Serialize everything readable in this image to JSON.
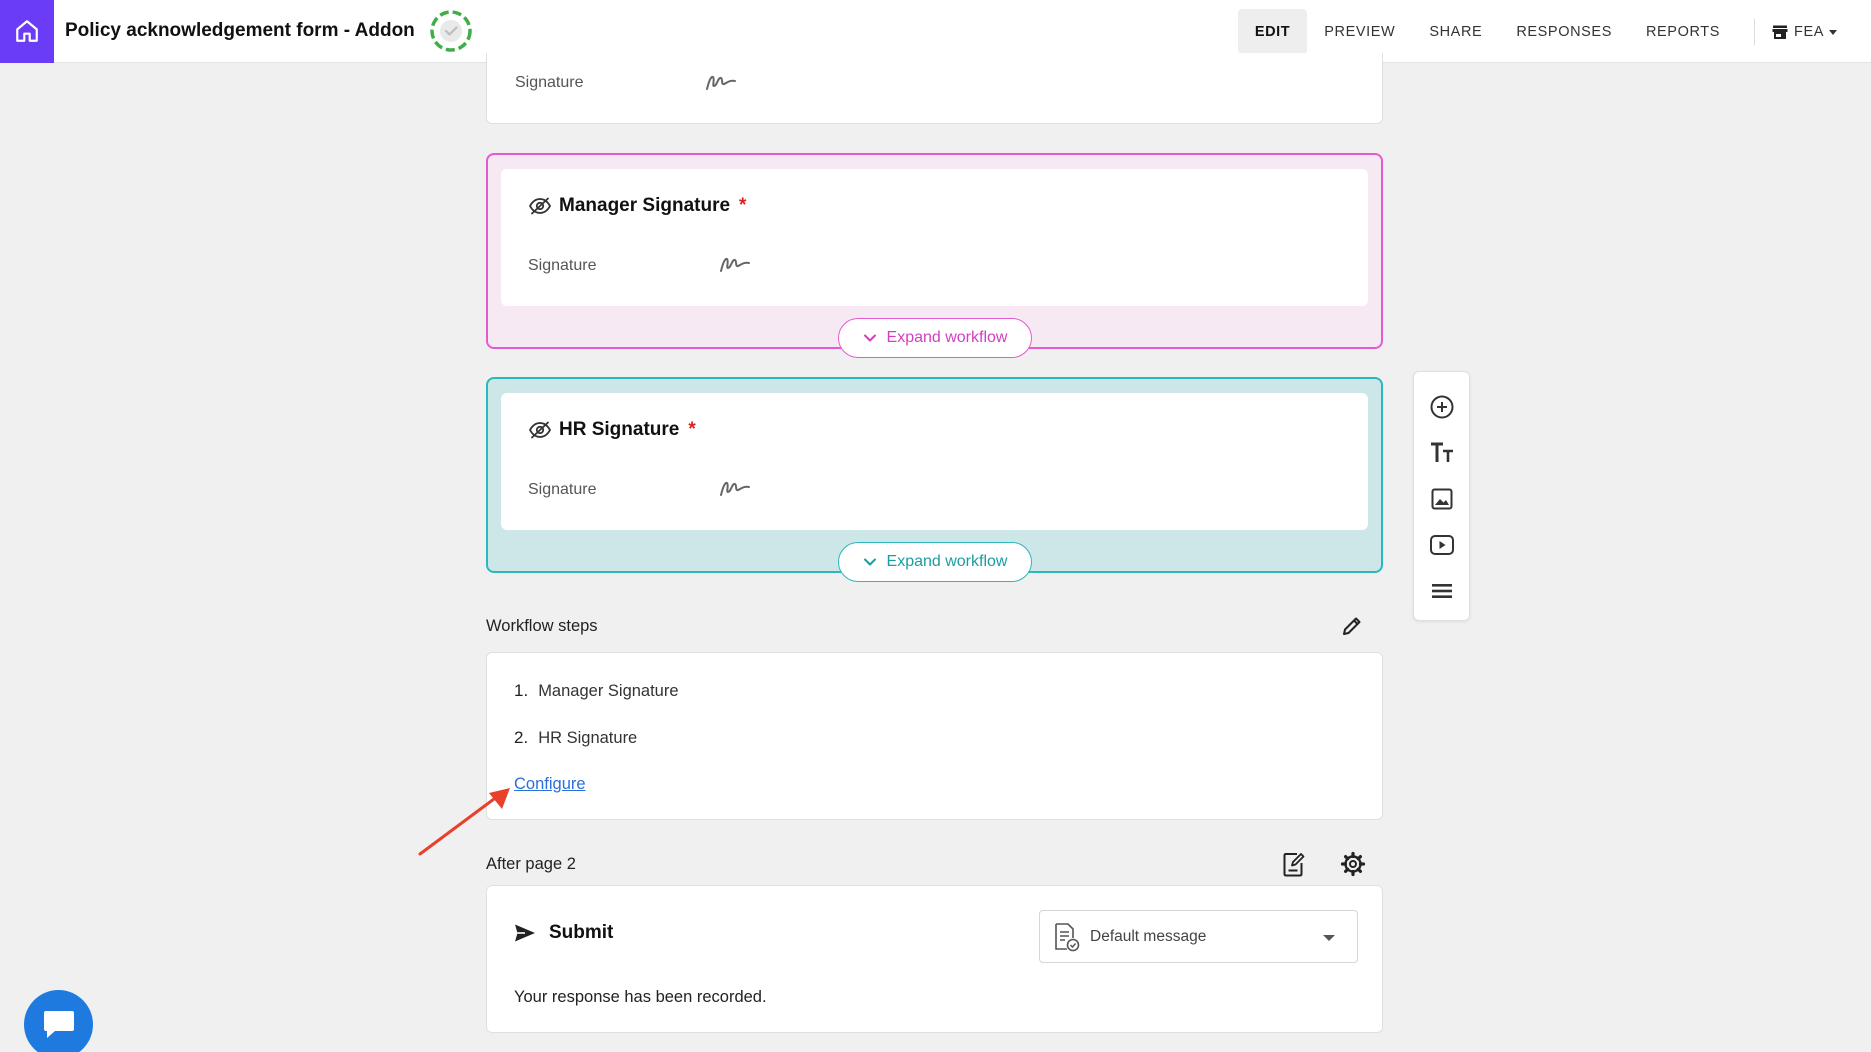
{
  "header": {
    "form_title": "Policy acknowledgement form - Addon",
    "nav": [
      {
        "label": "EDIT",
        "active": true
      },
      {
        "label": "PREVIEW",
        "active": false
      },
      {
        "label": "SHARE",
        "active": false
      },
      {
        "label": "RESPONSES",
        "active": false
      },
      {
        "label": "REPORTS",
        "active": false
      }
    ],
    "workspace": "FEA"
  },
  "top_card": {
    "signature_label": "Signature"
  },
  "manager_question": {
    "title": "Manager Signature",
    "required_mark": "*",
    "signature_label": "Signature",
    "expand_label": "Expand workflow"
  },
  "hr_question": {
    "title": "HR Signature",
    "required_mark": "*",
    "signature_label": "Signature",
    "expand_label": "Expand workflow"
  },
  "workflow": {
    "label": "Workflow steps",
    "steps": [
      {
        "num": "1.",
        "name": "Manager Signature"
      },
      {
        "num": "2.",
        "name": "HR Signature"
      }
    ],
    "configure_label": "Configure"
  },
  "after_page": {
    "label": "After page 2",
    "submit_label": "Submit",
    "message_select": "Default message",
    "response_text": "Your response has been recorded."
  },
  "colors": {
    "brand": "#6b3cf5",
    "pink_border": "#e35bd0",
    "teal_border": "#2bb7bb",
    "link": "#2a6fdb",
    "required": "#e02020",
    "arrow": "#e8402a",
    "chat": "#1f7ae0"
  },
  "icons": {
    "home": "home-icon",
    "status": "status-ring-icon",
    "workspace": "store-icon",
    "signature": "signature-scribble-icon",
    "hidden": "eye-off-icon",
    "chevron": "chevron-down-icon",
    "edit": "pencil-icon",
    "tools": [
      "add-circle-icon",
      "text-size-icon",
      "image-icon",
      "video-icon",
      "divider-icon"
    ],
    "page_logic": "note-edit-icon",
    "settings": "gear-icon",
    "submit": "send-icon",
    "message": "document-check-icon",
    "chat": "chat-bubble-icon"
  }
}
